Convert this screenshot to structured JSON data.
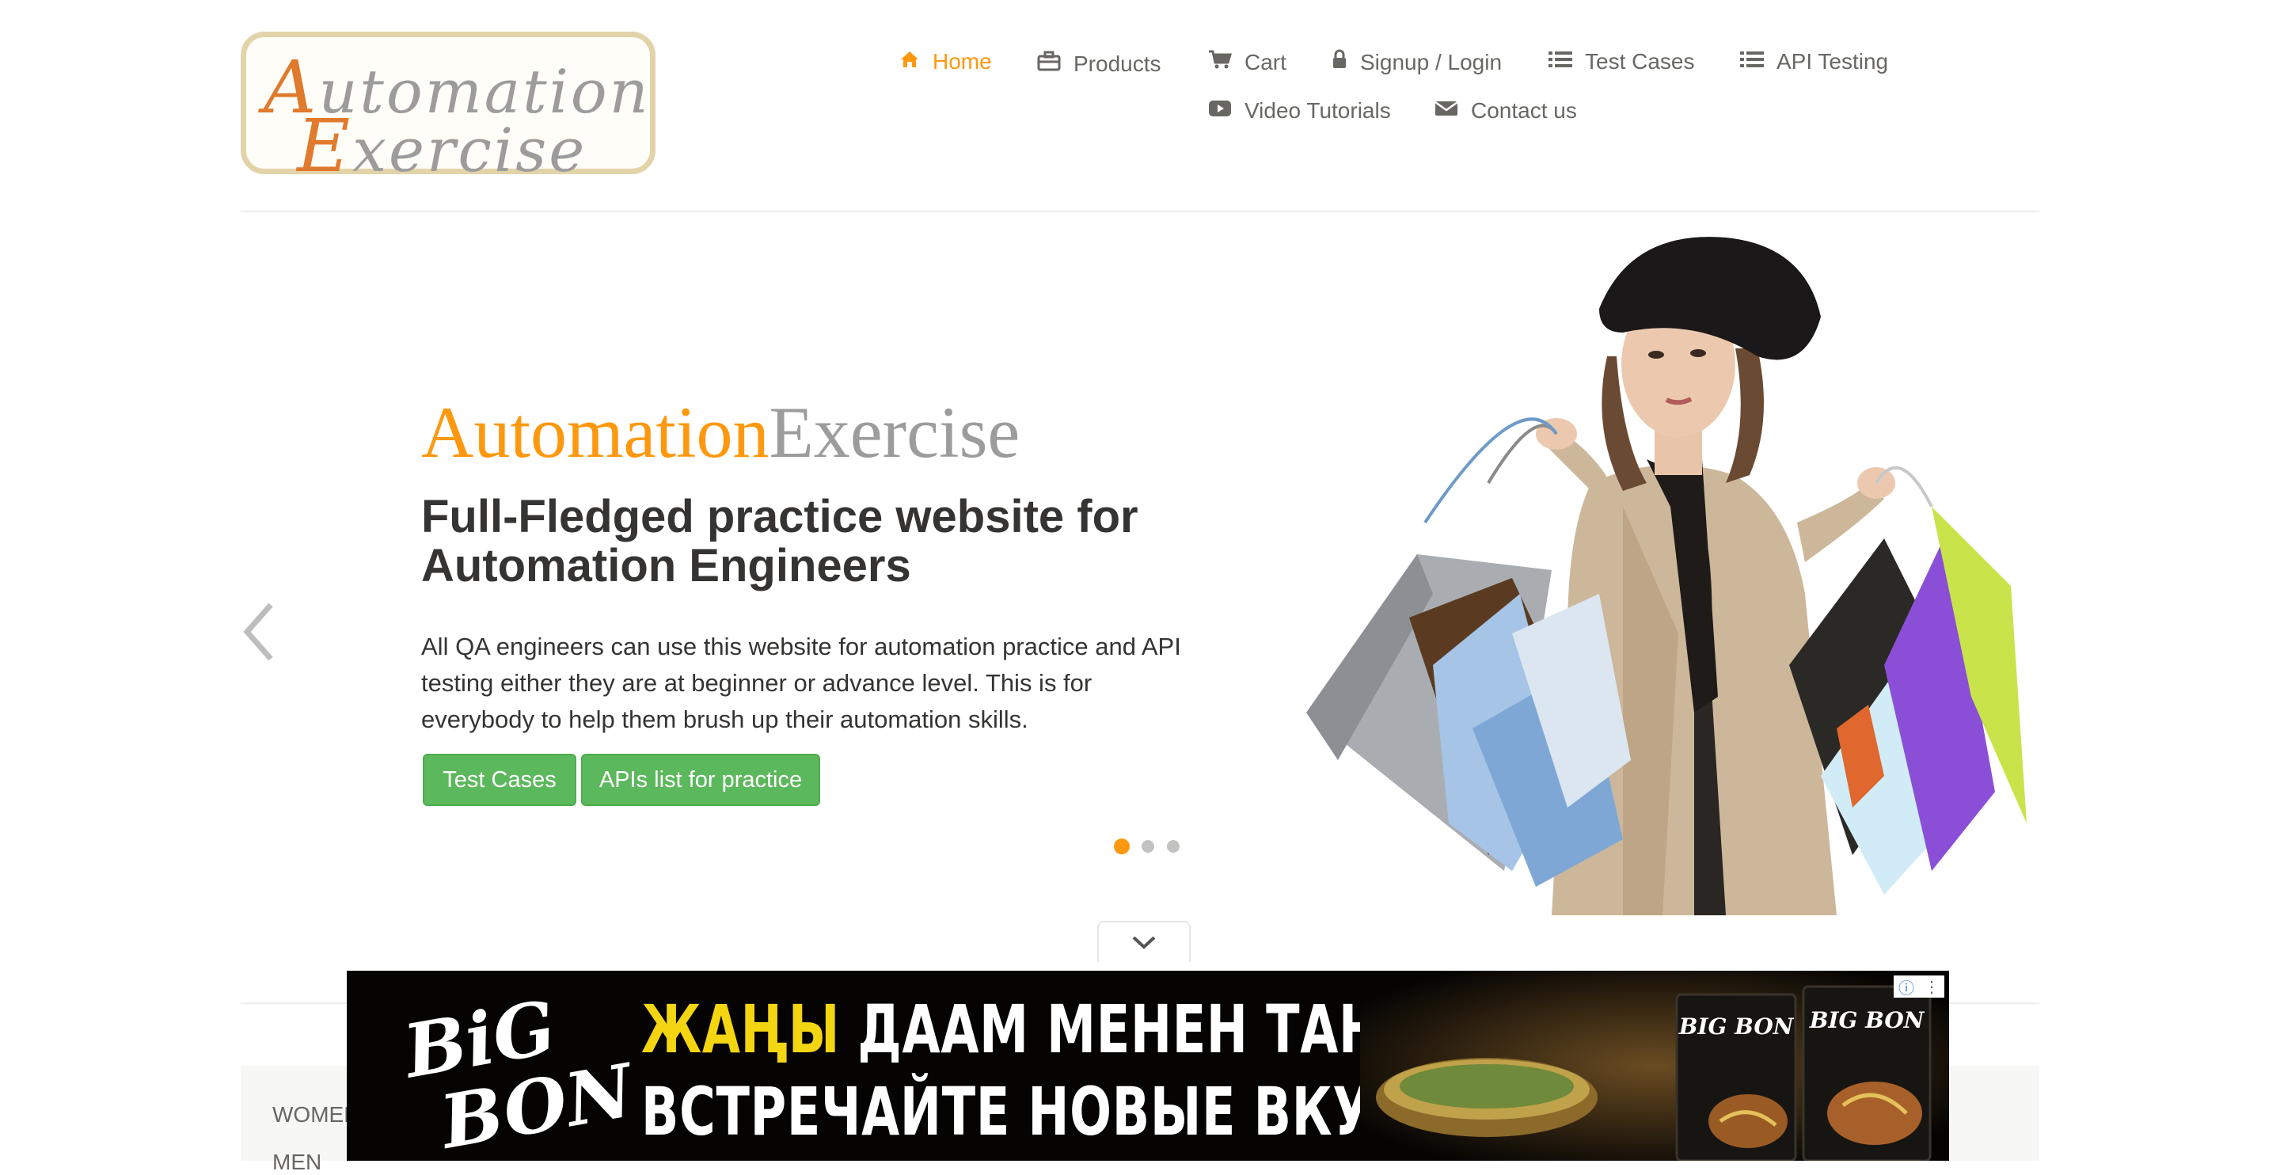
{
  "header": {
    "logo": {
      "line1_first": "A",
      "line1_rest": "utomation",
      "line2_first": "E",
      "line2_rest": "xercise"
    },
    "nav": [
      {
        "label": "Home",
        "icon": "home-icon",
        "active": true
      },
      {
        "label": "Products",
        "icon": "briefcase-icon"
      },
      {
        "label": "Cart",
        "icon": "cart-icon"
      },
      {
        "label": "Signup / Login",
        "icon": "lock-icon"
      },
      {
        "label": "Test Cases",
        "icon": "list-icon"
      },
      {
        "label": "API Testing",
        "icon": "list-icon"
      },
      {
        "label": "Video Tutorials",
        "icon": "youtube-play-icon"
      },
      {
        "label": "Contact us",
        "icon": "envelope-icon"
      }
    ]
  },
  "slider": {
    "brand_part1": "Automation",
    "brand_part2": "Exercise",
    "headline": "Full-Fledged practice website for Automation Engineers",
    "description": "All QA engineers can use this website for automation practice and API testing either they are at beginner or advance level. This is for everybody to help them brush up their automation skills.",
    "buttons": [
      "Test Cases",
      "APIs list for practice"
    ],
    "slides_count": 3,
    "active_slide": 1
  },
  "sidebar": {
    "categories": [
      "WOMEN",
      "MEN"
    ]
  },
  "ad": {
    "brand": "BIG BON",
    "line1_highlight": "ЖАҢЫ",
    "line1_rest": "ДААМ МЕНЕН ТАНЫШТЫРУУ",
    "line2": "ВСТРЕЧАЙТЕ НОВЫЕ ВКУСЫ",
    "package_label": "BIG BON",
    "info_icon": "info-icon",
    "menu_icon": "more-vertical-icon"
  },
  "colors": {
    "accent": "#fe980f",
    "button_green": "#5cb85c",
    "text_dark": "#363432",
    "text_muted": "#696763",
    "brand_gray": "#9c9c9c",
    "ad_yellow": "#f4d512"
  }
}
